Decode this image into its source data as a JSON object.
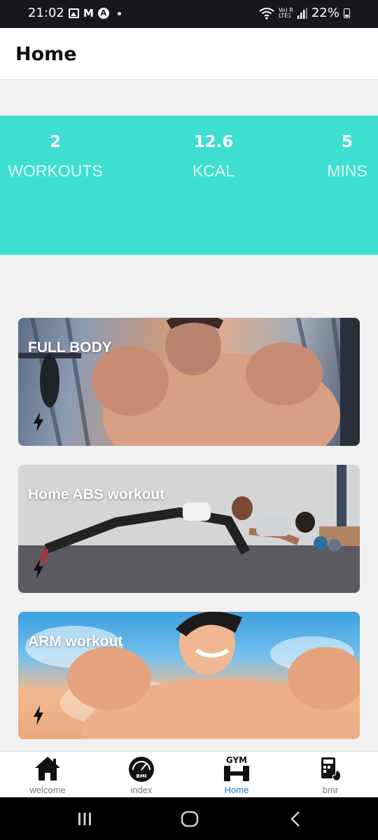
{
  "status_bar": {
    "time": "21:02",
    "m_label": "M",
    "a_label": "A",
    "lte_label": "Vo) R\nLTE1",
    "battery_text": "22%"
  },
  "app_bar": {
    "title": "Home"
  },
  "stats": [
    {
      "value": "2",
      "label": "WORKOUTS"
    },
    {
      "value": "12.6",
      "label": "KCAL"
    },
    {
      "value": "5",
      "label": "MINS"
    }
  ],
  "workouts": [
    {
      "title": "FULL BODY",
      "image": "muscular-man-gym-illustration"
    },
    {
      "title": "Home ABS workout",
      "image": "people-doing-plank-photo"
    },
    {
      "title": "ARM workout",
      "image": "flexing-man-sky-illustration"
    }
  ],
  "bottom_nav": {
    "items": [
      {
        "label": "welcome",
        "icon": "home-icon"
      },
      {
        "label": "index",
        "icon": "bmi-gauge-icon"
      },
      {
        "label": "Home",
        "icon": "gym-dumbbell-icon",
        "active": true
      },
      {
        "label": "bmr",
        "icon": "calculator-flame-icon"
      }
    ],
    "bmi_icon_text": "BMI",
    "gym_icon_text": "GYM"
  },
  "colors": {
    "accent": "#3edfd0",
    "active_nav": "#1976d2",
    "status_bar": "#17181c"
  }
}
